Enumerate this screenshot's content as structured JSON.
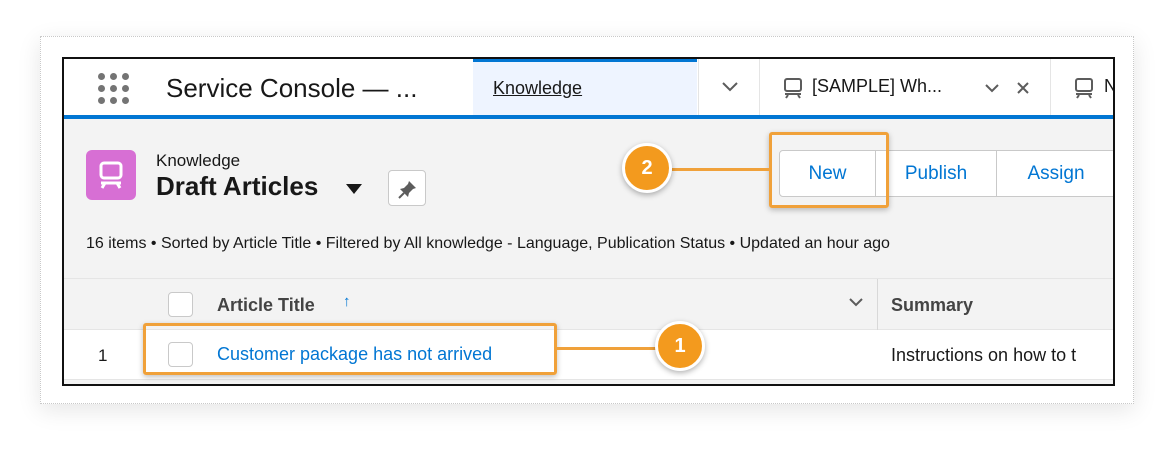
{
  "nav": {
    "app_name": "Service Console — ...",
    "tabs": [
      {
        "label": "Knowledge",
        "active": true
      },
      {
        "label": "[SAMPLE] Wh...",
        "active": false
      },
      {
        "label": "N",
        "active": false
      }
    ]
  },
  "header": {
    "object_label": "Knowledge",
    "list_view_title": "Draft Articles",
    "buttons": {
      "new": "New",
      "publish": "Publish",
      "assign": "Assign"
    }
  },
  "list_info": "16 items • Sorted by Article Title • Filtered by All knowledge - Language, Publication Status • Updated an hour ago",
  "table": {
    "columns": [
      "Article Title",
      "Summary"
    ],
    "sort_indicator": "↑",
    "rows": [
      {
        "number": "1",
        "title": "Customer package has not arrived",
        "summary": "Instructions on how to t"
      }
    ]
  },
  "callouts": [
    {
      "label": "1",
      "target": "first article row"
    },
    {
      "label": "2",
      "target": "New button"
    }
  ],
  "colors": {
    "brand_blue": "#0176d3",
    "knowledge_icon": "#d76fd4",
    "callout_orange": "#f39a1e"
  },
  "icons": [
    "app-launcher-icon",
    "chevron-down-icon",
    "article-icon",
    "close-icon",
    "pin-icon",
    "sort-ascending-icon"
  ]
}
